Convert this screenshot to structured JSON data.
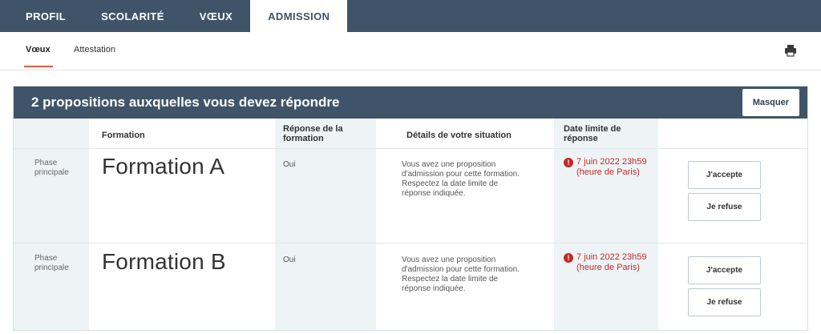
{
  "top_nav": {
    "tabs": [
      {
        "label": "PROFIL",
        "active": false
      },
      {
        "label": "SCOLARITÉ",
        "active": false
      },
      {
        "label": "VŒUX",
        "active": false
      },
      {
        "label": "ADMISSION",
        "active": true
      }
    ]
  },
  "sub_nav": {
    "tabs": [
      {
        "label": "Vœux",
        "active": true
      },
      {
        "label": "Attestation",
        "active": false
      }
    ],
    "print_icon": "printer-icon"
  },
  "panel": {
    "title": "2 propositions auxquelles vous devez répondre",
    "hide_label": "Masquer",
    "columns": {
      "formation": "Formation",
      "response": "Réponse de la formation",
      "details": "Détails de votre situation",
      "deadline": "Date limite de réponse"
    },
    "rows": [
      {
        "phase": "Phase principale",
        "formation": "Formation A",
        "response": "Oui",
        "details": "Vous avez une proposition d'admission pour cette formation. Respectez la date limite de réponse indiquée.",
        "deadline": "7 juin 2022 23h59 (heure de Paris)",
        "accept_label": "J'accepte",
        "refuse_label": "Je refuse"
      },
      {
        "phase": "Phase principale",
        "formation": "Formation B",
        "response": "Oui",
        "details": "Vous avez une proposition d'admission pour cette formation. Respectez la date limite de réponse indiquée.",
        "deadline": "7 juin 2022 23h59 (heure de Paris)",
        "accept_label": "J'accepte",
        "refuse_label": "Je refuse"
      }
    ]
  },
  "colors": {
    "nav_background": "#3f5468",
    "accent": "#e05b40",
    "deadline_red": "#c62828",
    "shaded_column": "#eef3f5"
  }
}
